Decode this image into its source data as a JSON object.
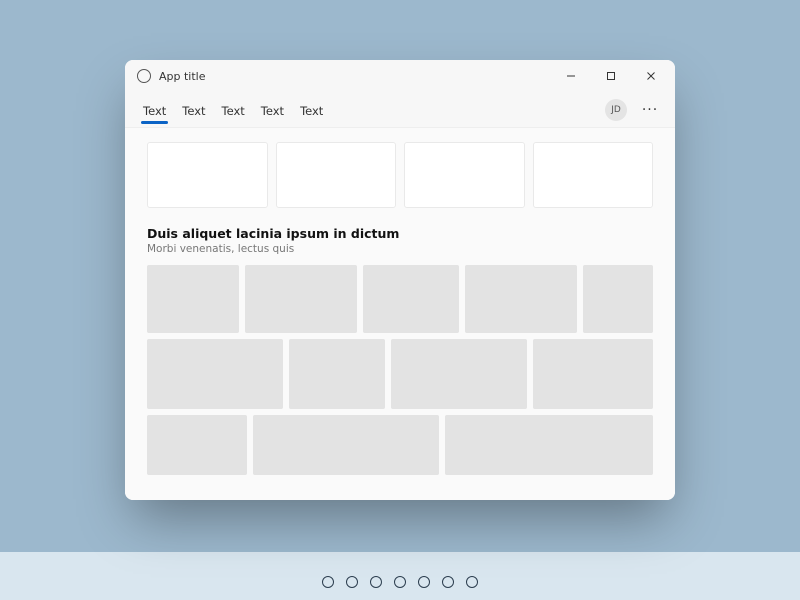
{
  "window": {
    "title": "App title",
    "avatar_initials": "JD"
  },
  "tabs": [
    {
      "label": "Text",
      "selected": true
    },
    {
      "label": "Text",
      "selected": false
    },
    {
      "label": "Text",
      "selected": false
    },
    {
      "label": "Text",
      "selected": false
    },
    {
      "label": "Text",
      "selected": false
    }
  ],
  "section": {
    "title": "Duis aliquet lacinia ipsum in dictum",
    "subtitle": "Morbi venenatis, lectus quis"
  },
  "pagination_dot_count": 7
}
